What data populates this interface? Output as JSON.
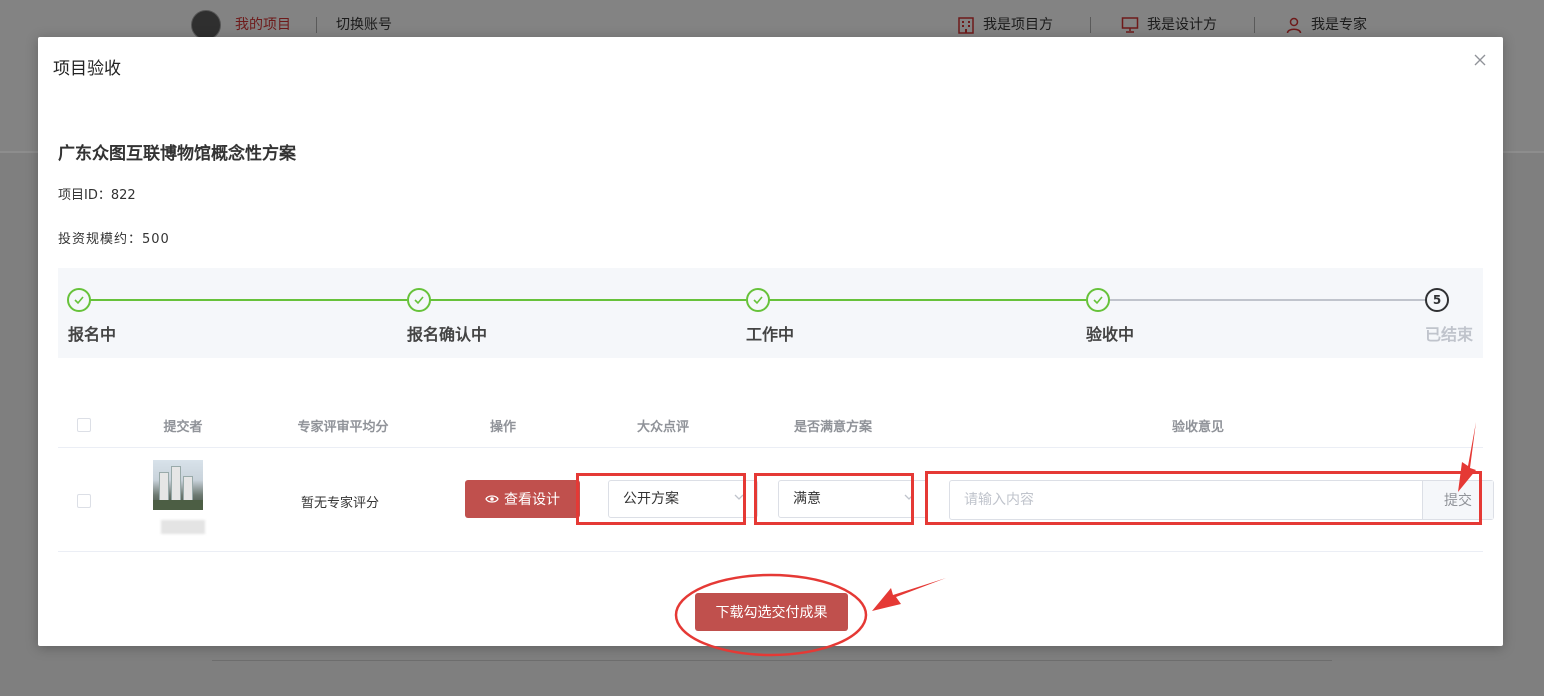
{
  "background": {
    "nav": {
      "my_projects": "我的项目",
      "switch_account": "切换账号"
    },
    "roles": [
      "我是项目方",
      "我是设计方",
      "我是专家"
    ]
  },
  "modal": {
    "title": "项目验收",
    "project_name": "广东众图互联博物馆概念性方案",
    "project_id": "项目ID：822",
    "investment": "投资规模约：500"
  },
  "steps": [
    {
      "label": "报名中",
      "status": "done"
    },
    {
      "label": "报名确认中",
      "status": "done"
    },
    {
      "label": "工作中",
      "status": "done"
    },
    {
      "label": "验收中",
      "status": "done"
    },
    {
      "label": "已结束",
      "status": "pending",
      "number": "5"
    }
  ],
  "table": {
    "headers": {
      "submitter": "提交者",
      "expert_avg": "专家评审平均分",
      "action": "操作",
      "public_review": "大众点评",
      "satisfied": "是否满意方案",
      "opinion": "验收意见"
    },
    "rows": [
      {
        "expert_score": "暂无专家评分",
        "view_button": "查看设计",
        "public_review_value": "公开方案",
        "satisfied_value": "满意",
        "opinion_placeholder": "请输入内容",
        "submit_label": "提交"
      }
    ]
  },
  "download_button": "下载勾选交付成果",
  "colors": {
    "primary_button": "#c0504d",
    "step_done": "#67c23a",
    "annotation": "#e53935"
  }
}
